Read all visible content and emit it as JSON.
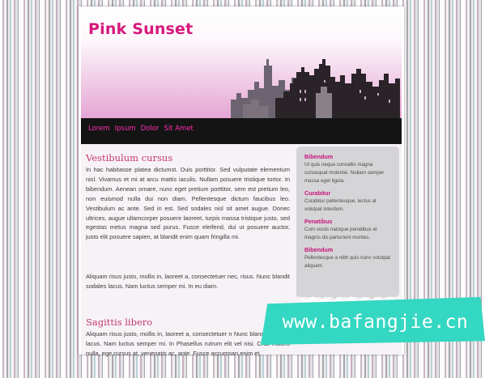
{
  "site": {
    "title": "Pink Sunset"
  },
  "nav": {
    "items": [
      "Lorem",
      "Ipsum",
      "Dolor",
      "Sit Amet"
    ]
  },
  "main": {
    "sections": [
      {
        "title": "Vestibulum cursus",
        "paragraphs": [
          "In hac habitasse platea dictumst. Duis porttitor. Sed vulputate elementum nisl. Vivamus et mi at arcu mattis iaculis. Nullam posuere tristique tortor. In bibendum. Aenean ornare, nunc eget pretium porttitor, sem est pretium leo, non euismod nulla dui non diam. Pellentesque dictum faucibus leo. Vestibulum ac ante. Sed in est. Sed sodales nisl sit amet augue. Donec ultrices, augue ullamcorper posuere laoreet, turpis massa tristique justo, sed egestas metus magna sed purus. Fusce eleifend, dui ut posuere auctor, justo elit posuere sapien, at blandit enim quam fringilla mi.",
          "Aliquam risus justo, mollis in, laoreet a, consectetuer nec, risus. Nunc blandit sodales lacus. Nam luctus semper mi. In eu diam."
        ]
      },
      {
        "title": "Sagittis libero",
        "paragraphs": [
          "Aliquam risus justo, mollis in, laoreet a, consectetuer n Nunc blandit sodales lacus. Nam luctus semper mi. In Phasellus rutrum elit vel nisi. Cras mauris nulla, ege cursus at, venenatis ac, ante. Fusce accumsan enim et"
        ]
      }
    ]
  },
  "sidebar": {
    "items": [
      {
        "title": "Bibendum",
        "text": "Ut quis neque convallis magna consequat molestie. Nullam semper massa eget ligula."
      },
      {
        "title": "Curabitur",
        "text": "Curabitur pellentesque, lectus at volutpat interdum."
      },
      {
        "title": "Penatibus",
        "text": "Cum sociis natoque penatibus et magnis dis parturient montes."
      },
      {
        "title": "Bibendum",
        "text": "Pellentesque a nibh quis nunc volutpat aliquam."
      }
    ]
  },
  "watermark": {
    "text": "www.bafangjie.cn"
  },
  "colors": {
    "title": "#d6187c",
    "nav_text": "#ff2fae",
    "nav_bg": "#141414",
    "section_title": "#c23a6a",
    "sidebar_title": "#c8127d",
    "sidebar_bg": "#d5d4d6",
    "watermark_bg": "#34d7c2"
  },
  "icons": {
    "header_art": "city-skyline-icon"
  }
}
